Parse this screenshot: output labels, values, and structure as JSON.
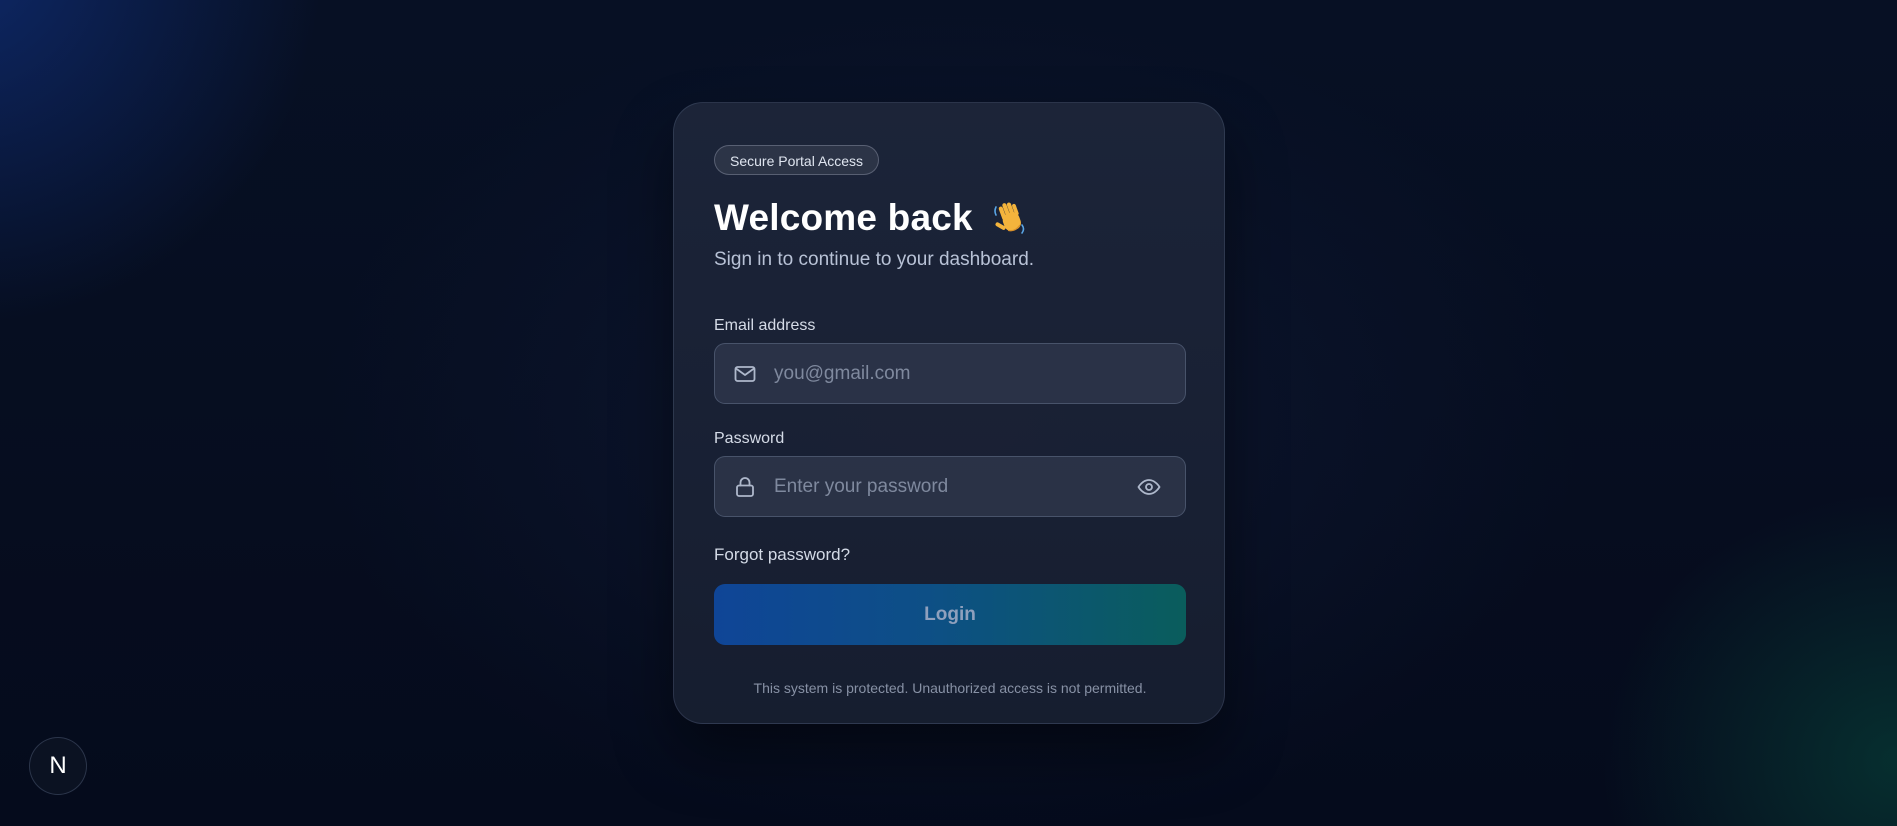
{
  "login_card": {
    "badge": "Secure Portal Access",
    "title": "Welcome back",
    "wave_emoji": "waving-hand-icon",
    "subtitle": "Sign in to continue to your dashboard.",
    "email": {
      "label": "Email address",
      "placeholder": "you@gmail.com",
      "value": "",
      "icon": "mail-icon"
    },
    "password": {
      "label": "Password",
      "placeholder": "Enter your password",
      "value": "",
      "icon": "lock-icon",
      "toggle_icon": "eye-icon"
    },
    "forgot_password": "Forgot password?",
    "login_button": "Login",
    "footer_note": "This system is protected. Unauthorized access is not permitted."
  },
  "dev_badge": {
    "label": "N"
  },
  "colors": {
    "background": "#060d1f",
    "card": "#1e263a",
    "button_start": "#0f4597",
    "button_end": "#0a5d5c"
  }
}
